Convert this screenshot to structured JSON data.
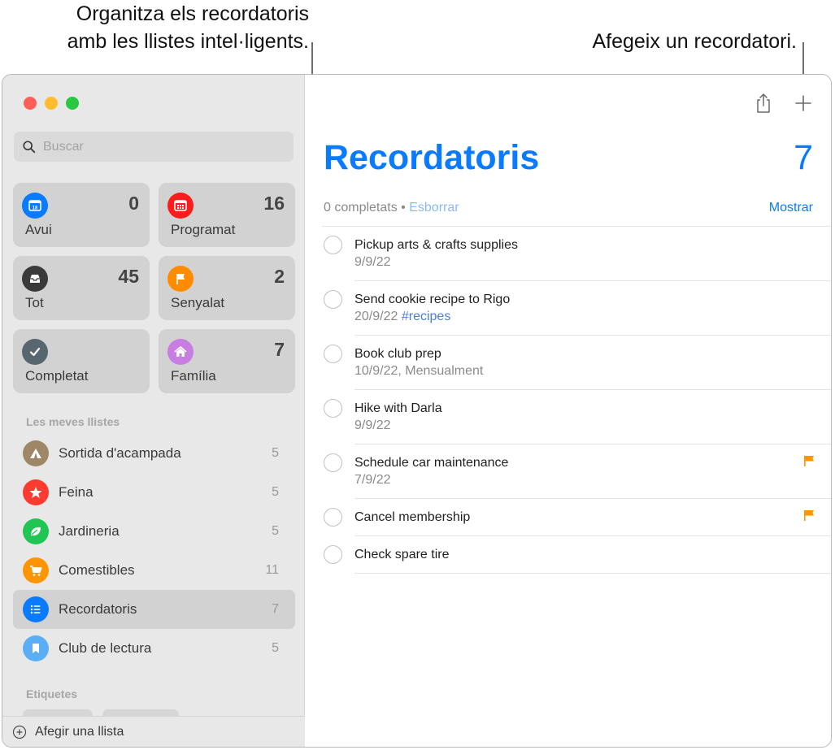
{
  "callouts": {
    "left_line1": "Organitza els recordatoris",
    "left_line2": "amb les llistes intel·ligents.",
    "right": "Afegeix un recordatori."
  },
  "sidebar": {
    "search_placeholder": "Buscar",
    "smart_lists": [
      {
        "label": "Avui",
        "count": "0",
        "icon": "calendar-today-icon",
        "color": "#0a7aff"
      },
      {
        "label": "Programat",
        "count": "16",
        "icon": "calendar-icon",
        "color": "#fe1d1d"
      },
      {
        "label": "Tot",
        "count": "45",
        "icon": "tray-icon",
        "color": "#3a3a3a"
      },
      {
        "label": "Senyalat",
        "count": "2",
        "icon": "flag-icon",
        "color": "#ff8c00"
      },
      {
        "label": "Completat",
        "count": "",
        "icon": "checkmark-icon",
        "color": "#586670"
      },
      {
        "label": "Família",
        "count": "7",
        "icon": "house-icon",
        "color": "#c87de3"
      }
    ],
    "my_lists_header": "Les meves llistes",
    "my_lists": [
      {
        "name": "Sortida d'acampada",
        "count": "5",
        "icon": "tent-icon",
        "color": "#9d8766"
      },
      {
        "name": "Feina",
        "count": "5",
        "icon": "star-icon",
        "color": "#fd3b30"
      },
      {
        "name": "Jardineria",
        "count": "5",
        "icon": "leaf-icon",
        "color": "#20c554"
      },
      {
        "name": "Comestibles",
        "count": "11",
        "icon": "cart-icon",
        "color": "#ff9500"
      },
      {
        "name": "Recordatoris",
        "count": "7",
        "icon": "list-icon",
        "color": "#0a7aff",
        "selected": true
      },
      {
        "name": "Club de lectura",
        "count": "5",
        "icon": "bookmark-icon",
        "color": "#5aaef5"
      }
    ],
    "tags_header": "Etiquetes",
    "add_list_label": "Afegir una llista"
  },
  "main": {
    "title": "Recordatoris",
    "count": "7",
    "completed_text": "0 completats",
    "separator": " • ",
    "clear_label": "Esborrar",
    "show_label": "Mostrar",
    "accent_color": "#0a7aff",
    "reminders": [
      {
        "title": "Pickup arts & crafts supplies",
        "subtitle": "9/9/22",
        "tag": "",
        "flagged": false
      },
      {
        "title": "Send cookie recipe to Rigo",
        "subtitle": "20/9/22",
        "tag": "#recipes",
        "flagged": false
      },
      {
        "title": "Book club prep",
        "subtitle": "10/9/22, Mensualment",
        "tag": "",
        "flagged": false
      },
      {
        "title": "Hike with Darla",
        "subtitle": "9/9/22",
        "tag": "",
        "flagged": false
      },
      {
        "title": "Schedule car maintenance",
        "subtitle": "7/9/22",
        "tag": "",
        "flagged": true
      },
      {
        "title": "Cancel membership",
        "subtitle": "",
        "tag": "",
        "flagged": true
      },
      {
        "title": "Check spare tire",
        "subtitle": "",
        "tag": "",
        "flagged": false
      }
    ]
  }
}
